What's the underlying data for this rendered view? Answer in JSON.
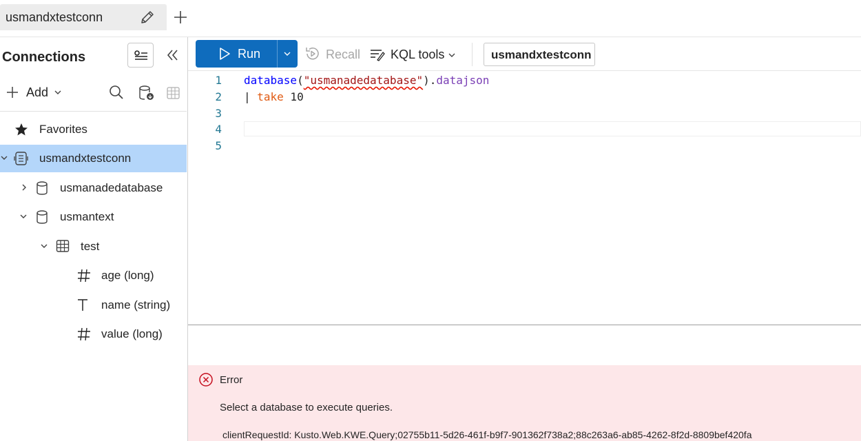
{
  "tabs": {
    "active_label": "usmandxtestconn",
    "rename_icon": "pencil-icon",
    "new_tab_icon": "plus-icon"
  },
  "connections_panel": {
    "title": "Connections",
    "add_label": "Add",
    "tree": [
      {
        "label": "Favorites",
        "icon": "star-icon",
        "level": 0
      },
      {
        "label": "usmandxtestconn",
        "icon": "cluster-icon",
        "level": 0,
        "expanded": true,
        "selected": true
      },
      {
        "label": "usmanadedatabase",
        "icon": "database-icon",
        "level": 1,
        "expanded": false
      },
      {
        "label": "usmantext",
        "icon": "database-icon",
        "level": 1,
        "expanded": true
      },
      {
        "label": "test",
        "icon": "table-icon",
        "level": 2,
        "expanded": true
      },
      {
        "label": "age (long)",
        "icon": "hash-icon",
        "level": 3
      },
      {
        "label": "name (string)",
        "icon": "text-type-icon",
        "level": 3
      },
      {
        "label": "value (long)",
        "icon": "hash-icon",
        "level": 3
      }
    ]
  },
  "toolbar": {
    "run_label": "Run",
    "recall_label": "Recall",
    "kql_tools_label": "KQL tools",
    "connection_context": "usmandxtestconn"
  },
  "editor": {
    "line_numbers": [
      "1",
      "2",
      "3",
      "4",
      "5"
    ],
    "line1": {
      "fn": "database",
      "open": "(",
      "str": "\"usmanadedatabase\"",
      "close": ").",
      "prop": "datajson"
    },
    "line2": {
      "pipe": "| ",
      "kw": "take",
      "num": " 10"
    }
  },
  "error": {
    "title": "Error",
    "message": "Select a database to execute queries.",
    "request_id": "clientRequestId: Kusto.Web.KWE.Query;02755b11-5d26-461f-b9f7-901362f738a2;88c263a6-ab85-4262-8f2d-8809bef420fa"
  },
  "colors": {
    "accent": "#0f6cbd",
    "selection": "#b4d6fa",
    "error_background": "#fde7e9",
    "error_icon": "#c50f1f"
  }
}
